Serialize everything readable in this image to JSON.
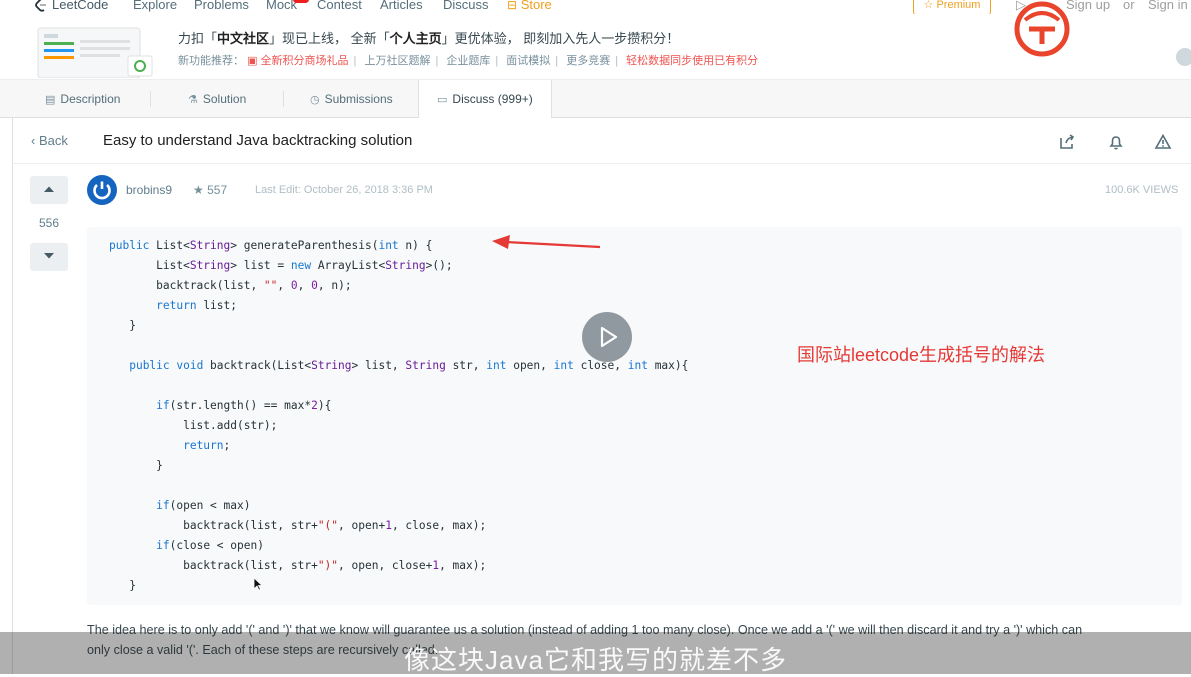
{
  "nav": {
    "brand": "LeetCode",
    "explore": "Explore",
    "problems": "Problems",
    "mock": "Mock",
    "contest": "Contest",
    "articles": "Articles",
    "discuss": "Discuss",
    "store": "Store",
    "premium": "☆ Premium",
    "sign_up": "Sign up",
    "or": "or",
    "sign_in": "Sign in"
  },
  "banner": {
    "line1_a": "力扣「",
    "line1_b": "中文社区",
    "line1_c": "」现已上线， 全新「",
    "line1_d": "个人主页",
    "line1_e": "」更优体验， 即刻加入先人一步攒积分！",
    "recommend_label": "新功能推荐：",
    "items": [
      "全新积分商场礼品",
      "上万社区题解",
      "企业题库",
      "面试模拟",
      "更多竞赛",
      "轻松数据同步使用已有积分"
    ]
  },
  "tabs": {
    "description": "Description",
    "solution": "Solution",
    "submissions": "Submissions",
    "discuss": "Discuss (999+)"
  },
  "post": {
    "back": "Back",
    "title": "Easy to understand Java backtracking solution",
    "votes": "556",
    "author": "brobins9",
    "reputation": "557",
    "last_edit": "Last Edit: October 26, 2018 3:36 PM",
    "views": "100.6K VIEWS",
    "body_line1": "The idea here is to only add '(' and ')' that we know will guarantee us a solution (instead of adding 1 too many close). Once we add a '(' we will then discard it and try a ')' which can",
    "body_line2": "only close a valid '('. Each of these steps are recursively called."
  },
  "overlay": {
    "annotation": "国际站leetcode生成括号的解法",
    "subtitle": "像这块Java它和我写的就差不多"
  },
  "colors": {
    "accent_orange": "#f0a020",
    "annotation_red": "#e53935"
  }
}
